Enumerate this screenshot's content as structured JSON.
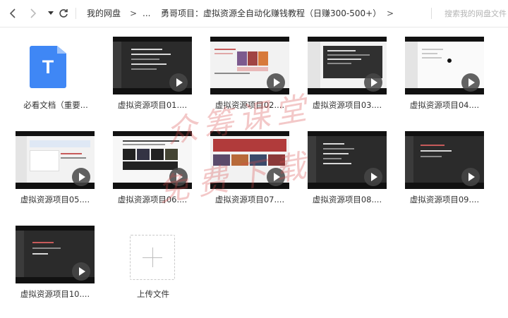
{
  "nav": {
    "breadcrumb_root": "我的网盘",
    "breadcrumb_sep": ">",
    "breadcrumb_more": "...",
    "breadcrumb_current": "勇哥项目：虚拟资源全自动化赚钱教程（日赚300-500+）",
    "search_placeholder": "搜索我的网盘文件"
  },
  "files": [
    {
      "name": "必看文档（重要...",
      "type": "document",
      "icon_letter": "T"
    },
    {
      "name": "虚拟资源项目01....",
      "type": "video"
    },
    {
      "name": "虚拟资源项目02....",
      "type": "video"
    },
    {
      "name": "虚拟资源项目03....",
      "type": "video"
    },
    {
      "name": "虚拟资源项目04....",
      "type": "video"
    },
    {
      "name": "虚拟资源项目05....",
      "type": "video"
    },
    {
      "name": "虚拟资源项目06....",
      "type": "video"
    },
    {
      "name": "虚拟资源项目07....",
      "type": "video"
    },
    {
      "name": "虚拟资源项目08....",
      "type": "video"
    },
    {
      "name": "虚拟资源项目09....",
      "type": "video"
    },
    {
      "name": "虚拟资源项目10....",
      "type": "video"
    }
  ],
  "upload": {
    "label": "上传文件"
  },
  "watermark": {
    "line1": "众筹课堂",
    "line2": "免费下载"
  },
  "colors": {
    "doc_blue": "#3f87f5",
    "watermark_red": "#d94b4b",
    "border": "#e9e9e9"
  }
}
